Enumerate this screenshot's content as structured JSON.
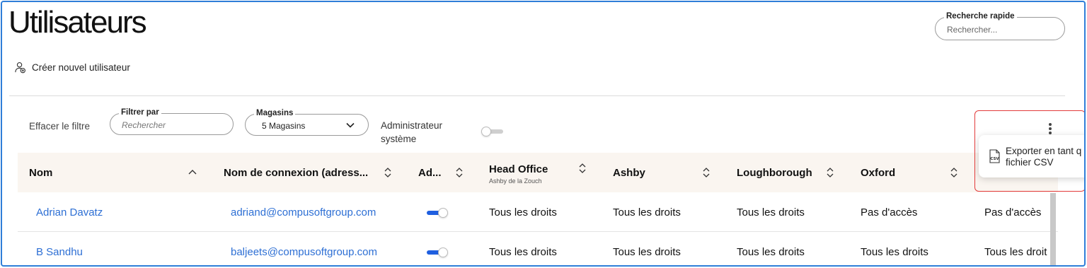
{
  "page": {
    "title": "Utilisateurs"
  },
  "quick_search": {
    "legend": "Recherche rapide",
    "placeholder": "Rechercher..."
  },
  "actions": {
    "create_user": "Créer nouvel utilisateur"
  },
  "filters": {
    "clear_label": "Effacer le filtre",
    "filter_by": {
      "legend": "Filtrer par",
      "placeholder": "Rechercher"
    },
    "stores": {
      "legend": "Magasins",
      "value": "5 Magasins"
    },
    "system_admin": {
      "label_line1": "Administrateur",
      "label_line2": "système",
      "enabled": false
    }
  },
  "menu": {
    "export_csv_line1": "Exporter en tant q",
    "export_csv_line2": "fichier CSV",
    "csv_icon_text": "CSV"
  },
  "table": {
    "columns": [
      {
        "label": "Nom",
        "sub": ""
      },
      {
        "label": "Nom de connexion (adress...",
        "sub": ""
      },
      {
        "label": "Ad...",
        "sub": ""
      },
      {
        "label": "Head Office",
        "sub": "Ashby de la Zouch"
      },
      {
        "label": "Ashby",
        "sub": ""
      },
      {
        "label": "Loughborough",
        "sub": ""
      },
      {
        "label": "Oxford",
        "sub": ""
      }
    ],
    "rows": [
      {
        "name": "Adrian Davatz",
        "login": "adriand@compusoftgroup.com",
        "admin": true,
        "head_office": "Tous les droits",
        "ashby": "Tous les droits",
        "loughborough": "Tous les droits",
        "oxford": "Pas d'accès",
        "extra": "Pas d'accès"
      },
      {
        "name": "B Sandhu",
        "login": "baljeets@compusoftgroup.com",
        "admin": true,
        "head_office": "Tous les droits",
        "ashby": "Tous les droits",
        "loughborough": "Tous les droits",
        "oxford": "Tous les droits",
        "extra": "Tous les droit"
      }
    ]
  },
  "colors": {
    "accent_blue": "#1f5fe0",
    "link": "#2d6fd4",
    "header_bg": "#faf5f0",
    "highlight_red": "#e23b3b"
  }
}
